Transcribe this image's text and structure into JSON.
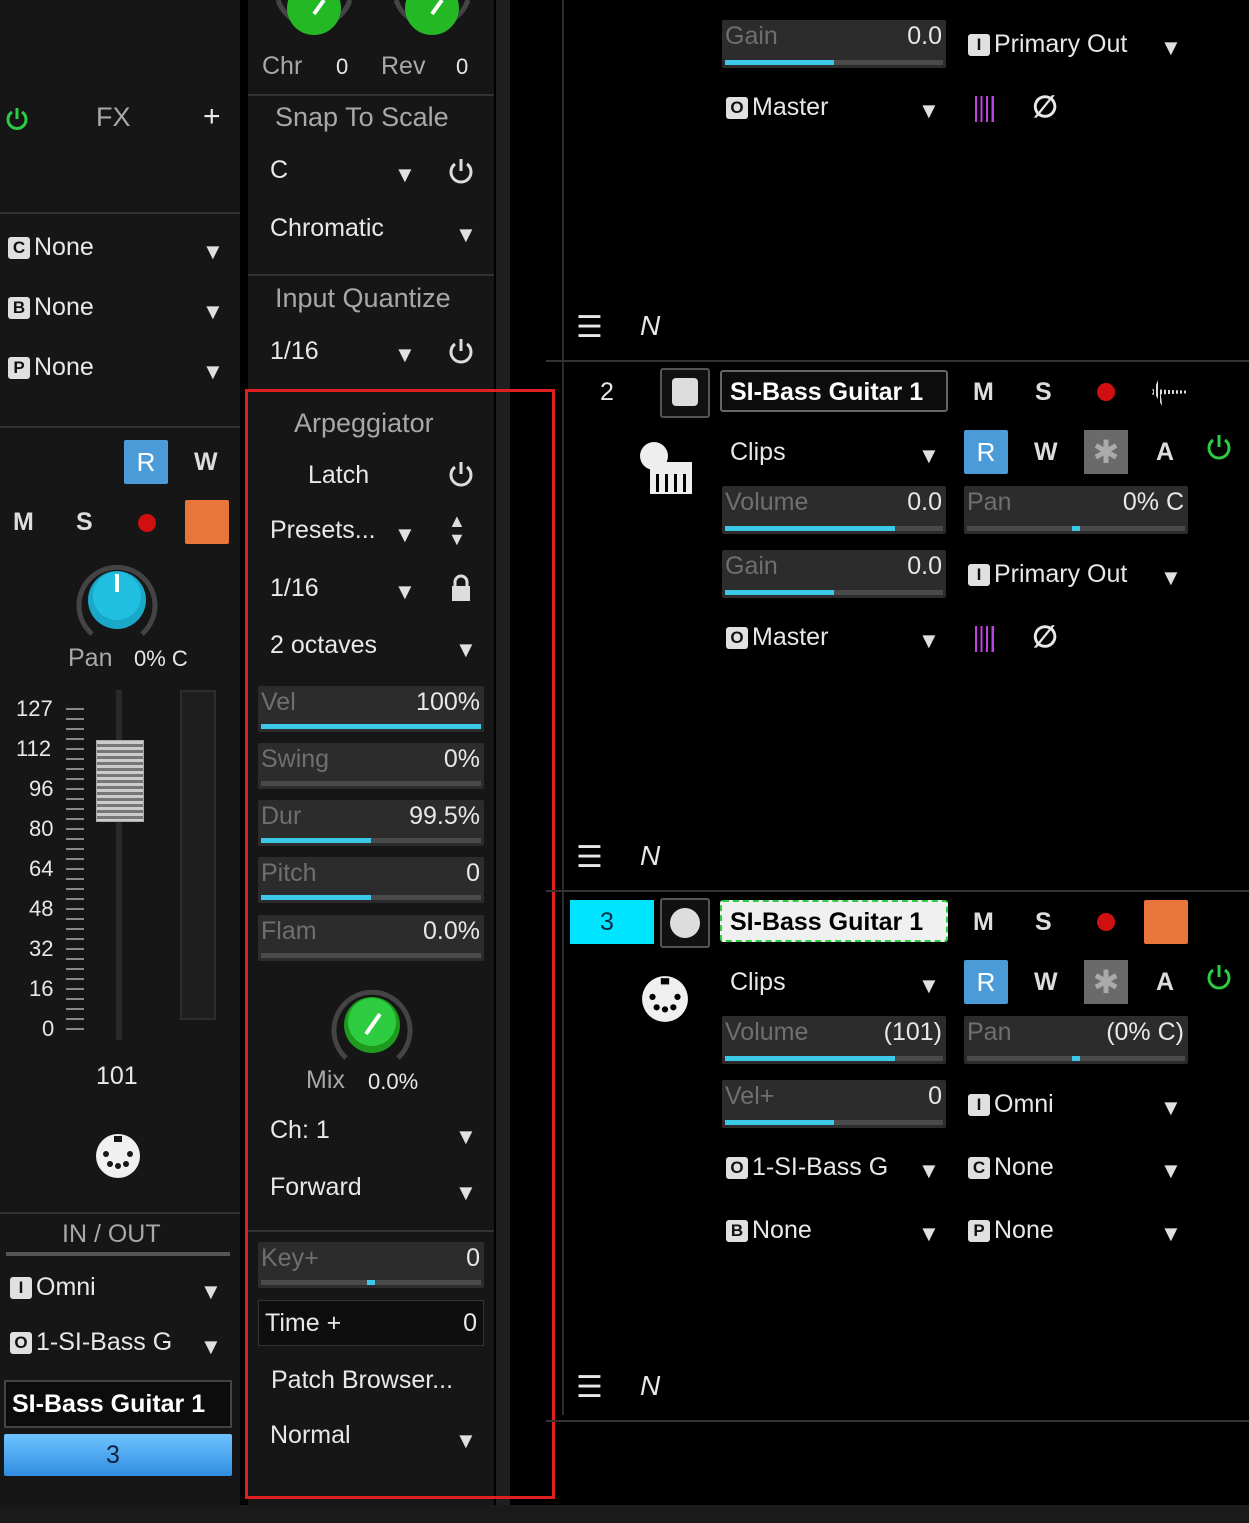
{
  "colors": {
    "accent": "#3cc8e8",
    "highlight_box": "#e02020",
    "power_green": "#2ecc40",
    "record": "#d01010",
    "r_button": "#4a9bd8",
    "track_select": "#00e5ff"
  },
  "left": {
    "fx_label": "FX",
    "fx_add": "+",
    "sends": [
      {
        "badge": "C",
        "value": "None"
      },
      {
        "badge": "B",
        "value": "None"
      },
      {
        "badge": "P",
        "value": "None"
      }
    ],
    "r_label": "R",
    "w_label": "W",
    "m_label": "M",
    "s_label": "S",
    "pan_label": "Pan",
    "pan_value": "0% C",
    "scale_ticks": [
      "127",
      "112",
      "96",
      "80",
      "64",
      "48",
      "32",
      "16",
      "0"
    ],
    "fader_value": "101",
    "inout_label": "IN / OUT",
    "input": {
      "badge": "I",
      "value": "Omni"
    },
    "output": {
      "badge": "O",
      "value": "1-SI-Bass G"
    },
    "track_name": "SI-Bass Guitar 1",
    "track_number": "3"
  },
  "middle": {
    "chr_label": "Chr",
    "chr_value": "0",
    "rev_label": "Rev",
    "rev_value": "0",
    "snap_title": "Snap To Scale",
    "snap_key": "C",
    "snap_scale": "Chromatic",
    "iq_title": "Input Quantize",
    "iq_value": "1/16",
    "arp": {
      "title": "Arpeggiator",
      "latch": "Latch",
      "presets": "Presets...",
      "rate": "1/16",
      "octaves": "2 octaves",
      "sliders": [
        {
          "name": "Vel",
          "value": "100%",
          "fill": 1.0
        },
        {
          "name": "Swing",
          "value": "0%",
          "fill": 0.0
        },
        {
          "name": "Dur",
          "value": "99.5%",
          "fill": 0.5
        },
        {
          "name": "Pitch",
          "value": "0",
          "fill": 0.5
        },
        {
          "name": "Flam",
          "value": "0.0%",
          "fill": 0.0
        }
      ],
      "mix_label": "Mix",
      "mix_value": "0.0%",
      "channel": "Ch: 1",
      "direction": "Forward"
    },
    "key_plus": {
      "name": "Key+",
      "value": "0",
      "fill": 0.5
    },
    "time_plus": {
      "name": "Time +",
      "value": "0"
    },
    "patch_browser": "Patch Browser...",
    "mode": "Normal"
  },
  "tracks": {
    "t1": {
      "gain": {
        "name": "Gain",
        "value": "0.0",
        "fill": 0.5
      },
      "out": {
        "badge": "I",
        "value": "Primary Out"
      },
      "master": {
        "badge": "O",
        "value": "Master"
      }
    },
    "t2": {
      "number": "2",
      "name": "SI-Bass Guitar 1",
      "m": "M",
      "s": "S",
      "clips": "Clips",
      "r": "R",
      "w": "W",
      "a": "A",
      "volume": {
        "name": "Volume",
        "value": "0.0",
        "fill": 0.78
      },
      "pan": {
        "name": "Pan",
        "value": "0% C",
        "fill": 0.5
      },
      "gain": {
        "name": "Gain",
        "value": "0.0",
        "fill": 0.5
      },
      "out": {
        "badge": "I",
        "value": "Primary Out"
      },
      "master": {
        "badge": "O",
        "value": "Master"
      }
    },
    "t3": {
      "number": "3",
      "name": "SI-Bass Guitar 1",
      "m": "M",
      "s": "S",
      "clips": "Clips",
      "r": "R",
      "w": "W",
      "a": "A",
      "volume": {
        "name": "Volume",
        "value": "(101)",
        "fill": 0.78
      },
      "pan": {
        "name": "Pan",
        "value": "(0% C)",
        "fill": 0.5
      },
      "vel": {
        "name": "Vel+",
        "value": "0",
        "fill": 0.5
      },
      "input": {
        "badge": "I",
        "value": "Omni"
      },
      "output": {
        "badge": "O",
        "value": "1-SI-Bass G"
      },
      "c": {
        "badge": "C",
        "value": "None"
      },
      "b": {
        "badge": "B",
        "value": "None"
      },
      "p": {
        "badge": "P",
        "value": "None"
      }
    }
  }
}
